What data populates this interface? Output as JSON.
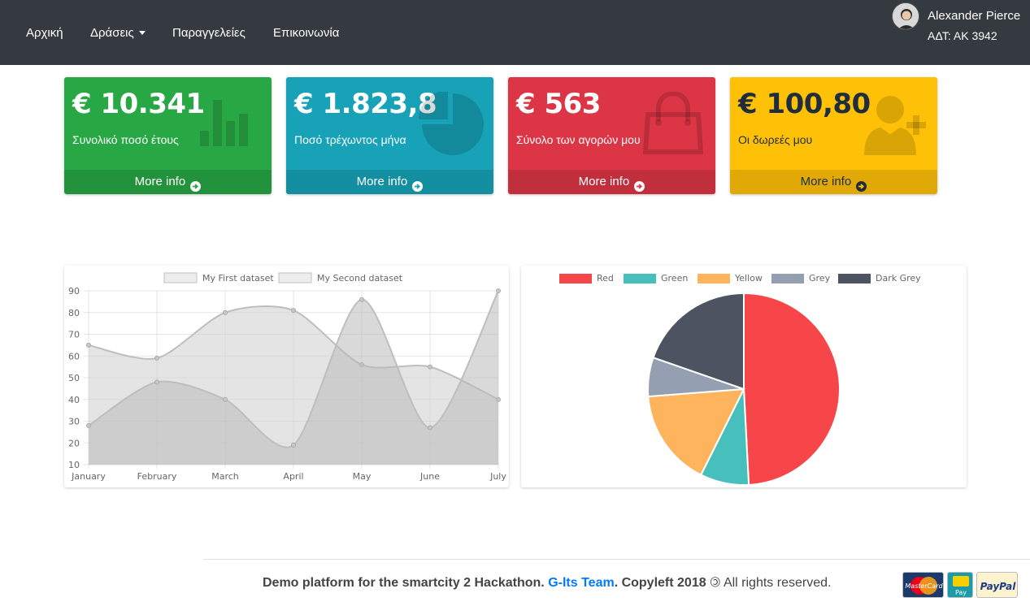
{
  "nav": {
    "items": [
      {
        "label": "Αρχική",
        "dropdown": false
      },
      {
        "label": "Δράσεις",
        "dropdown": true
      },
      {
        "label": "Παραγγελείες",
        "dropdown": false
      },
      {
        "label": "Επικοινωνία",
        "dropdown": false
      }
    ],
    "user": {
      "name": "Alexander Pierce",
      "id": "ΑΔΤ: ΑΚ 3942"
    }
  },
  "boxes": [
    {
      "value": "€ 10.341",
      "label": "Συνολικό ποσό έτους",
      "footer": "More info",
      "color": "#28a745",
      "icon": "bar-chart-icon"
    },
    {
      "value": "€ 1.823,8",
      "label": "Ποσό τρέχωντος μήνα",
      "footer": "More info",
      "color": "#17a2b8",
      "icon": "pie-chart-icon"
    },
    {
      "value": "€ 563",
      "label": "Σύνολο των αγορών μου",
      "footer": "More info",
      "color": "#dc3545",
      "icon": "shopping-bag-icon"
    },
    {
      "value": "€ 100,80",
      "label": "Οι δωρεές μου",
      "footer": "More info",
      "color": "#ffc107",
      "icon": "user-plus-icon"
    }
  ],
  "chart_data": [
    {
      "type": "area",
      "categories": [
        "January",
        "February",
        "March",
        "April",
        "May",
        "June",
        "July"
      ],
      "series": [
        {
          "name": "My First dataset",
          "values": [
            65,
            59,
            80,
            81,
            56,
            55,
            40
          ]
        },
        {
          "name": "My Second dataset",
          "values": [
            28,
            48,
            40,
            19,
            86,
            27,
            90
          ]
        }
      ],
      "ylim": [
        10,
        90
      ],
      "yticks": [
        10,
        20,
        30,
        40,
        50,
        60,
        70,
        80,
        90
      ],
      "grid": true,
      "legend": "top"
    },
    {
      "type": "pie",
      "categories": [
        "Red",
        "Green",
        "Yellow",
        "Grey",
        "Dark Grey"
      ],
      "values": [
        300,
        50,
        100,
        40,
        120
      ],
      "colors": [
        "#F7464A",
        "#46BFBD",
        "#FDB45C",
        "#949FB1",
        "#4D5360"
      ],
      "legend": "top"
    }
  ],
  "footer": {
    "text_before": "Demo platform for the smartcity 2 Hackathon. ",
    "team": "G-lts Team",
    "text_after": ". Copyleft 2018 ",
    "rights": " All rights reserved.",
    "payments": [
      "MasterCard",
      "Pay",
      "PayPal"
    ]
  }
}
